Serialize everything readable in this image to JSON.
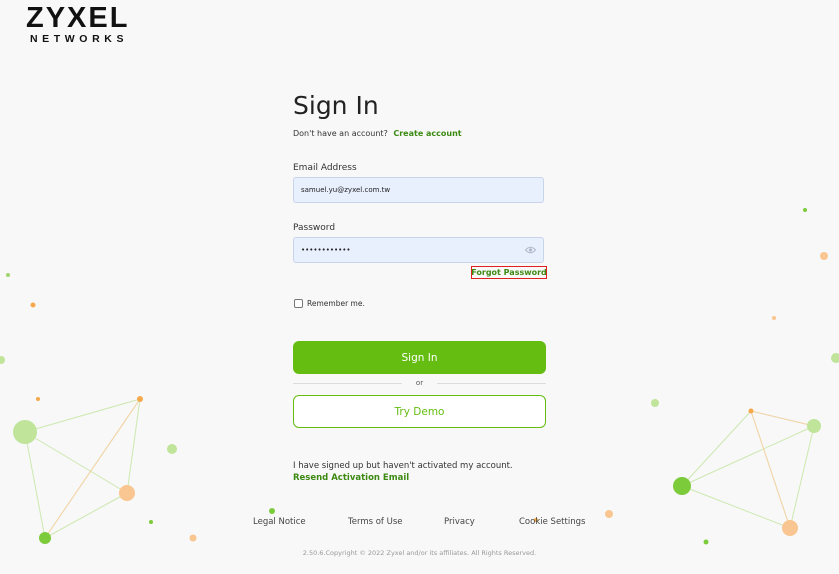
{
  "brand": {
    "name": "ZYXEL",
    "tagline": "NETWORKS"
  },
  "signin": {
    "title": "Sign In",
    "no_account_text": "Don't have an account?",
    "create_account": "Create account",
    "email_label": "Email Address",
    "email_value": "samuel.yu@zyxel.com.tw",
    "password_label": "Password",
    "password_value": "••••••••••••",
    "forgot_password": "Forgot Password",
    "remember_me": "Remember me.",
    "signin_button": "Sign In",
    "or_text": "or",
    "demo_button": "Try Demo",
    "activation_text": "I have signed up but haven't activated my account.",
    "resend_activation": "Resend Activation Email"
  },
  "footer": {
    "legal": "Legal Notice",
    "terms": "Terms of Use",
    "privacy": "Privacy",
    "cookies": "Cookie Settings",
    "copyright": "2.50.6.Copyright © 2022 Zyxel and/or its affiliates. All Rights Reserved."
  },
  "colors": {
    "accent_green": "#64bd10",
    "link_green": "#3d8a13",
    "highlight_red": "#e02020",
    "deco_green": "#9ed46a",
    "deco_orange": "#f8c48a"
  }
}
